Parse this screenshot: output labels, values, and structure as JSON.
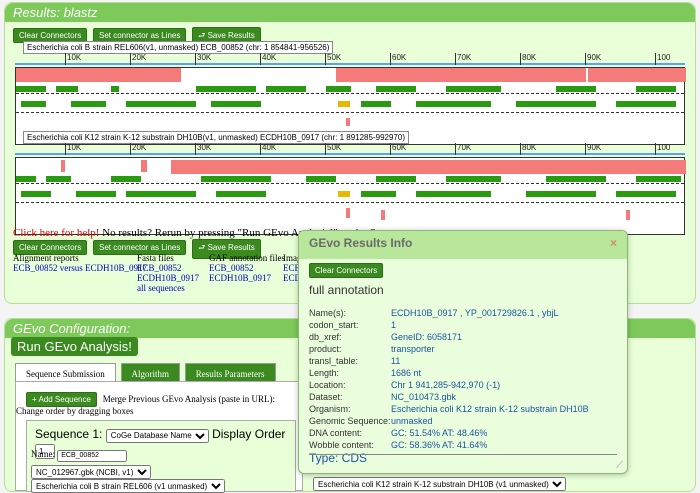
{
  "results": {
    "title": "Results: blastz",
    "buttons": [
      "Clear Connectors",
      "Set connector as Lines",
      "Save Results"
    ],
    "seq1_label": "Escherichia coli B strain REL606(v1, unmasked) ECB_00852 (chr: 1 854841-956526)",
    "seq2_label": "Escherichia coli K12 strain K-12 substrain DH10B(v1, unmasked) ECDH10B_0917 (chr: 1 891285-992970)",
    "ticks": [
      "10K",
      "20K",
      "30K",
      "40K",
      "50K",
      "60K",
      "70K",
      "80K",
      "90K",
      "100"
    ],
    "help_link": "Click here for help!",
    "no_results": "No results? Rerun by pressing \"Run GEvo Analysis!\" again. St",
    "report_headers": [
      "Alignment reports",
      "Fasta files",
      "GAF annotation files",
      "Imag"
    ],
    "alignment_link": "ECB_00852 versus ECDH10B_0917",
    "fasta_links": [
      "ECB_00852",
      "ECDH10B_0917",
      "all sequences"
    ],
    "gaf_links": [
      "ECB_00852",
      "ECDH10B_0917"
    ],
    "image_links": [
      "ECB",
      "ECD"
    ]
  },
  "config": {
    "title": "GEvo Configuration:",
    "run_button": "Run GEvo Analysis!",
    "tabs": [
      "Sequence Submission",
      "Algorithm",
      "Results Parameters"
    ],
    "add_seq": "Add Sequence",
    "merge_text": "Merge Previous GEvo Analysis (paste in URL):",
    "reorder_text": "Change order by dragging boxes",
    "seq_label": "Sequence 1:",
    "db_option": "CoGe Database Name",
    "display_order_label": "Display Order",
    "display_order_value": "1",
    "name_label": "Name:",
    "name_value": "ECB_00852",
    "dataset_option": "NC_012967.gbk (NCBI, v1)",
    "org_option": "Escherichia coli B strain REL606 (v1 unmasked)",
    "org_option2": "Escherichia coli K12 strain K-12 substrain DH10B (v1 unmasked)"
  },
  "info": {
    "title": "GEvo Results Info",
    "close": "×",
    "clear_btn": "Clear Connectors",
    "annotation": "full annotation",
    "rows": [
      {
        "k": "Name(s):",
        "v": "ECDH10B_0917 , YP_001729826.1 , ybjL"
      },
      {
        "k": "codon_start:",
        "v": "1"
      },
      {
        "k": "db_xref:",
        "v": "GeneID: 6058171"
      },
      {
        "k": "product:",
        "v": "transporter"
      },
      {
        "k": "transl_table:",
        "v": "11"
      },
      {
        "k": "Length:",
        "v": "1686 nt"
      },
      {
        "k": "Location:",
        "v": "Chr 1 941,285-942,970 (-1)"
      },
      {
        "k": "Dataset:",
        "v": "NC_010473.gbk"
      },
      {
        "k": "Organism:",
        "v": "Escherichia coli K12 strain K-12 substrain DH10B"
      },
      {
        "k": "Genomic Sequence:",
        "v": "unmasked"
      },
      {
        "k": "DNA content:",
        "v": "GC: 51.54% AT: 48.46%"
      },
      {
        "k": "Wobble content:",
        "v": "GC: 58.36% AT: 41.64%"
      }
    ],
    "type": "Type: CDS"
  }
}
